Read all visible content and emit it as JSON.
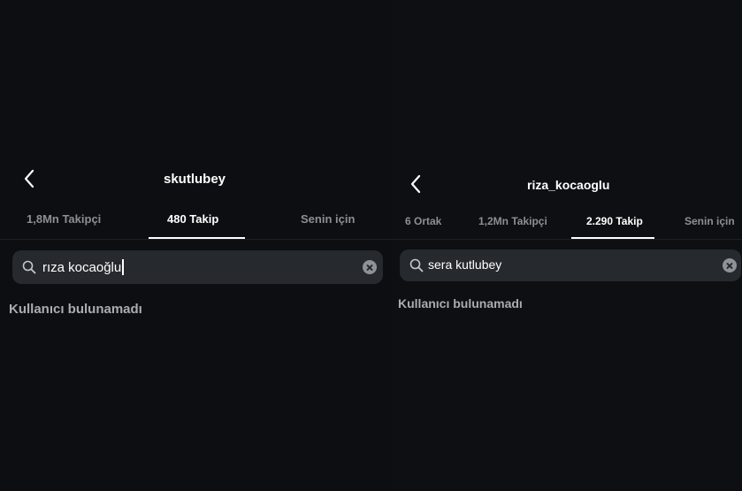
{
  "left": {
    "header": {
      "title": "skutlubey"
    },
    "tabs": [
      {
        "label": "1,8Mn Takipçi",
        "active": false
      },
      {
        "label": "480 Takip",
        "active": true
      },
      {
        "label": "Senin için",
        "active": false
      }
    ],
    "search": {
      "value": "rıza kocaoğlu",
      "placeholder": ""
    },
    "empty_message": "Kullanıcı bulunamadı"
  },
  "right": {
    "header": {
      "title": "riza_kocaoglu"
    },
    "tabs": [
      {
        "label": "6 Ortak",
        "active": false
      },
      {
        "label": "1,2Mn Takipçi",
        "active": false
      },
      {
        "label": "2.290 Takip",
        "active": true
      },
      {
        "label": "Senin için",
        "active": false
      }
    ],
    "search": {
      "value": "sera kutlubey",
      "placeholder": ""
    },
    "empty_message": "Kullanıcı bulunamadı"
  },
  "colors": {
    "background": "#0c0e11",
    "search_field": "#26292e",
    "inactive_tab": "#8c8f94",
    "active_tab": "#ffffff",
    "empty_text": "#a9acb1"
  },
  "icons": [
    "chevron-left-icon",
    "search-icon",
    "clear-icon"
  ]
}
